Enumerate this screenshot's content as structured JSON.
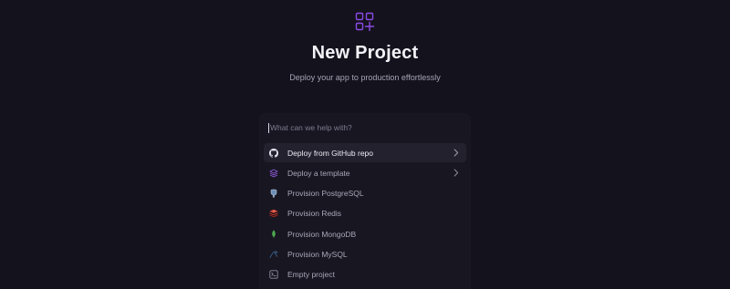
{
  "header": {
    "title": "New Project",
    "subtitle": "Deploy your app to production effortlessly",
    "logo_icon": "grid-plus-icon",
    "accent_color": "#8a4be4"
  },
  "search": {
    "placeholder": "What can we help with?",
    "value": ""
  },
  "menu": {
    "items": [
      {
        "label": "Deploy from GitHub repo",
        "icon": "github-icon",
        "has_chevron": true,
        "active": true
      },
      {
        "label": "Deploy a template",
        "icon": "layers-icon",
        "has_chevron": true,
        "active": false
      },
      {
        "label": "Provision PostgreSQL",
        "icon": "postgresql-icon",
        "has_chevron": false,
        "active": false
      },
      {
        "label": "Provision Redis",
        "icon": "redis-icon",
        "has_chevron": false,
        "active": false
      },
      {
        "label": "Provision MongoDB",
        "icon": "mongodb-icon",
        "has_chevron": false,
        "active": false
      },
      {
        "label": "Provision MySQL",
        "icon": "mysql-icon",
        "has_chevron": false,
        "active": false
      },
      {
        "label": "Empty project",
        "icon": "empty-project-icon",
        "has_chevron": false,
        "active": false
      }
    ]
  }
}
